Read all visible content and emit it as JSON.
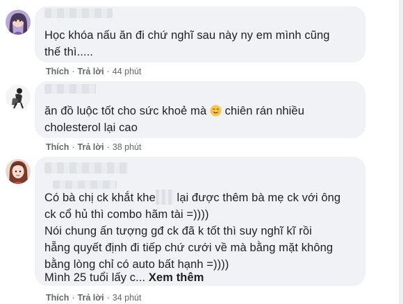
{
  "comments": [
    {
      "avatar": "girl-avatar-purple",
      "lines": [
        "Học khóa nấu ăn đi chứ nghĩ sau này ny em mình cũng",
        "thế thì....."
      ],
      "actions": {
        "like": "Thích",
        "reply": "Trả lời",
        "time": "44 phút"
      }
    },
    {
      "avatar": "sketch-avatar",
      "line1": "ăn đồ luộc tốt cho sức khoẻ mà",
      "line1_after": "chiên rán nhiều",
      "line2": "cholesterol lại cao",
      "emoji": "smiling-face-emoji",
      "actions": {
        "like": "Thích",
        "reply": "Trả lời",
        "time": "38 phút"
      }
    },
    {
      "avatar": "girl-avatar-red",
      "line1_a": "Có bà chị ck khắt khe",
      "line1_b": "lại được thêm bà mẹ ck với ông",
      "lines": [
        "ck cổ hủ thì combo hãm tài =))))",
        "Nói chung ấn tượng gđ ck đã k tốt thì suy nghĩ kĩ rồi",
        "hẵng quyết định đi tiếp chứ cưới về mà bằng mặt không",
        "bằng lòng chỉ có auto bất hạnh =))))"
      ],
      "last_line": "Mình 25 tuổi lấy c...",
      "see_more": "Xem thêm",
      "actions": {
        "like": "Thích",
        "reply": "Trả lời",
        "time": "34 phút"
      }
    }
  ],
  "colors": {
    "bubble": "#f0f2f5",
    "text": "#1c1e21",
    "meta": "#65676b"
  }
}
